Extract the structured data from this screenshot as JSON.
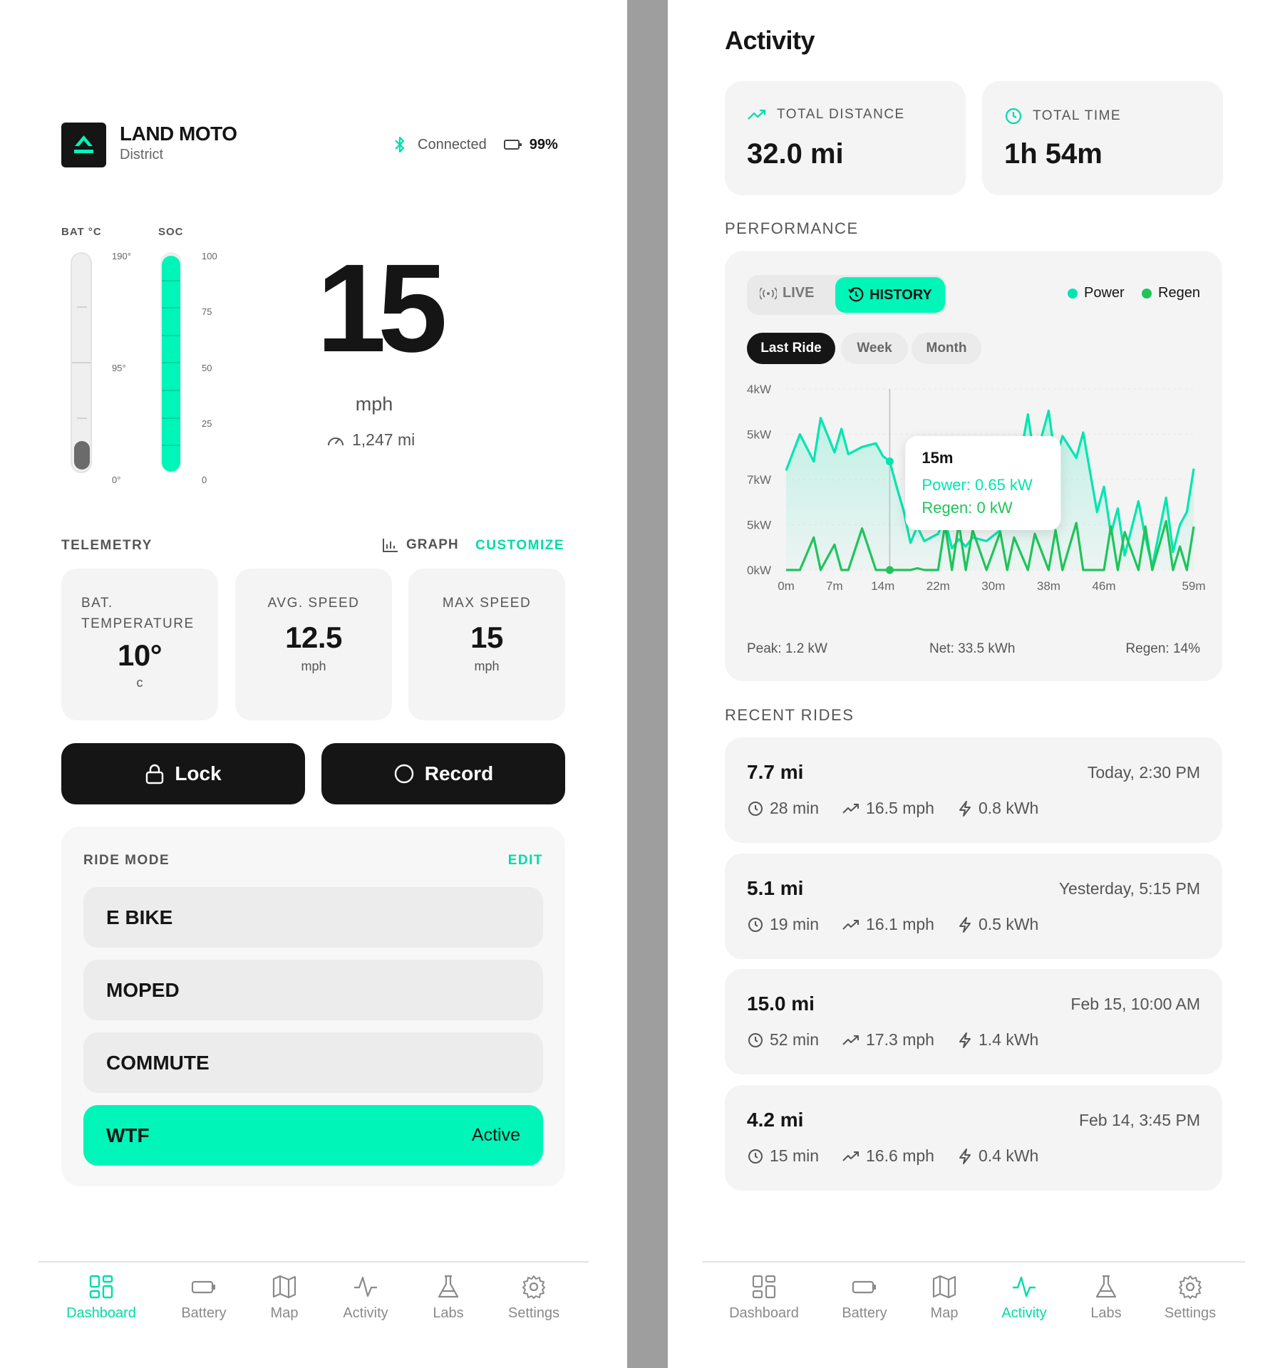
{
  "dashboard": {
    "brand": {
      "name": "LAND MOTO",
      "model": "District"
    },
    "status": {
      "connection": "Connected",
      "battery_percent": "99%"
    },
    "gauges": {
      "temp_label": "BAT °C",
      "soc_label": "SOC",
      "temp_ticks": [
        "190°",
        "95°",
        "0°"
      ],
      "soc_ticks": [
        "100",
        "75",
        "50",
        "25",
        "0"
      ],
      "temp_level": 0.12,
      "soc_level": 0.99
    },
    "speed": {
      "value": "15",
      "unit": "mph",
      "odometer": "1,247 mi"
    },
    "telemetry": {
      "title": "TELEMETRY",
      "graph_label": "GRAPH",
      "customize_label": "CUSTOMIZE",
      "cards": [
        {
          "label": "BAT. TEMPERATURE",
          "value": "10°",
          "unit": "c"
        },
        {
          "label": "AVG. SPEED",
          "value": "12.5",
          "unit": "mph"
        },
        {
          "label": "MAX SPEED",
          "value": "15",
          "unit": "mph"
        }
      ]
    },
    "actions": {
      "lock_label": "Lock",
      "record_label": "Record"
    },
    "ride_mode": {
      "title": "RIDE MODE",
      "edit_label": "EDIT",
      "modes": [
        {
          "label": "E BIKE",
          "status": ""
        },
        {
          "label": "MOPED",
          "status": ""
        },
        {
          "label": "COMMUTE",
          "status": ""
        },
        {
          "label": "WTF",
          "status": "Active"
        }
      ]
    }
  },
  "nav_left": {
    "items": [
      {
        "label": "Dashboard",
        "icon": "dashboard-icon"
      },
      {
        "label": "Battery",
        "icon": "battery-icon"
      },
      {
        "label": "Map",
        "icon": "map-icon"
      },
      {
        "label": "Activity",
        "icon": "activity-icon"
      },
      {
        "label": "Labs",
        "icon": "flask-icon"
      },
      {
        "label": "Settings",
        "icon": "gear-icon"
      }
    ],
    "active": "Dashboard"
  },
  "activity": {
    "title": "Activity",
    "summary": {
      "distance_label": "TOTAL DISTANCE",
      "distance_value": "32.0 mi",
      "time_label": "TOTAL TIME",
      "time_value": "1h 54m"
    },
    "performance": {
      "title": "PERFORMANCE",
      "live_label": "LIVE",
      "history_label": "HISTORY",
      "legend_power": "Power",
      "legend_regen": "Regen",
      "ranges": [
        "Last Ride",
        "Week",
        "Month"
      ],
      "tooltip": {
        "time": "15m",
        "power": "Power: 0.65 kW",
        "regen": "Regen: 0 kW"
      },
      "peak": "Peak: 1.2 kW",
      "net": "Net: 33.5 kWh",
      "regen_pct": "Regen: 14%"
    },
    "recent_rides_title": "RECENT RIDES",
    "rides": [
      {
        "distance": "7.7 mi",
        "date": "Today, 2:30 PM",
        "duration": "28 min",
        "speed": "16.5 mph",
        "energy": "0.8 kWh"
      },
      {
        "distance": "5.1 mi",
        "date": "Yesterday, 5:15 PM",
        "duration": "19 min",
        "speed": "16.1 mph",
        "energy": "0.5 kWh"
      },
      {
        "distance": "15.0 mi",
        "date": "Feb 15, 10:00 AM",
        "duration": "52 min",
        "speed": "17.3 mph",
        "energy": "1.4 kWh"
      },
      {
        "distance": "4.2 mi",
        "date": "Feb 14, 3:45 PM",
        "duration": "15 min",
        "speed": "16.6 mph",
        "energy": "0.4 kWh"
      }
    ]
  },
  "nav_right": {
    "items": [
      {
        "label": "Dashboard",
        "icon": "dashboard-icon"
      },
      {
        "label": "Battery",
        "icon": "battery-icon"
      },
      {
        "label": "Map",
        "icon": "map-icon"
      },
      {
        "label": "Activity",
        "icon": "activity-icon"
      },
      {
        "label": "Labs",
        "icon": "flask-icon"
      },
      {
        "label": "Settings",
        "icon": "gear-icon"
      }
    ],
    "active": "Activity"
  },
  "chart_data": {
    "type": "line",
    "title": "",
    "xlabel": "",
    "ylabel": "",
    "x_tick_labels": [
      "0m",
      "7m",
      "14m",
      "22m",
      "30m",
      "38m",
      "46m",
      "59m"
    ],
    "y_tick_labels": [
      "4kW",
      "5kW",
      "7kW",
      "5kW",
      "0kW"
    ],
    "x": [
      0,
      2,
      4,
      5,
      7,
      8,
      9,
      11,
      13,
      14,
      15,
      16,
      17,
      18,
      19,
      20,
      22,
      23,
      24,
      25,
      26,
      27,
      29,
      31,
      32,
      33,
      35,
      36,
      38,
      39,
      40,
      42,
      43,
      45,
      46,
      47,
      48,
      49,
      51,
      52,
      53,
      55,
      56,
      57,
      58,
      59
    ],
    "series": [
      {
        "name": "Power",
        "values": [
          5.5,
          7.5,
          6.0,
          8.4,
          6.5,
          7.8,
          6.4,
          6.8,
          7.0,
          6.3,
          6.0,
          4.6,
          3.3,
          1.5,
          2.4,
          1.6,
          2.0,
          2.8,
          1.2,
          1.7,
          1.3,
          1.8,
          1.6,
          2.2,
          3.1,
          4.4,
          8.6,
          6.0,
          8.8,
          6.0,
          7.4,
          6.2,
          7.6,
          3.2,
          4.6,
          2.0,
          3.4,
          0.8,
          3.8,
          1.8,
          0.2,
          4.0,
          1.0,
          2.5,
          3.2,
          5.6
        ]
      },
      {
        "name": "Regen",
        "values": [
          0,
          0,
          1.8,
          0,
          1.4,
          0,
          0,
          2.3,
          0,
          0,
          0,
          0,
          0,
          0,
          0.1,
          0,
          0,
          2.5,
          0,
          2.6,
          0,
          2.2,
          0,
          2.1,
          0,
          1.8,
          0,
          2.0,
          0,
          2.2,
          0,
          2.6,
          0,
          0,
          0,
          2.4,
          0,
          2.1,
          0,
          2.4,
          0,
          2.7,
          0,
          1.3,
          0,
          2.4
        ]
      }
    ],
    "ylim": [
      0,
      10
    ],
    "tooltip_x": 15,
    "legend": "top-right",
    "grid": true
  }
}
